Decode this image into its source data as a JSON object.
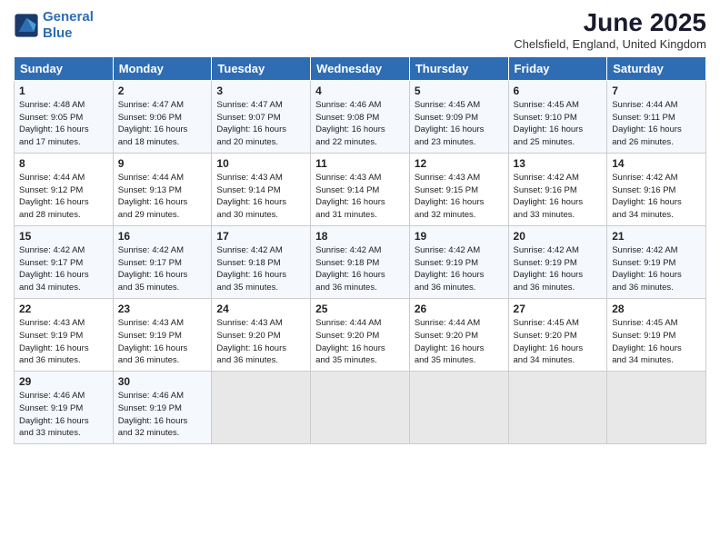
{
  "logo": {
    "line1": "General",
    "line2": "Blue"
  },
  "title": "June 2025",
  "subtitle": "Chelsfield, England, United Kingdom",
  "days_of_week": [
    "Sunday",
    "Monday",
    "Tuesday",
    "Wednesday",
    "Thursday",
    "Friday",
    "Saturday"
  ],
  "weeks": [
    [
      {
        "day": 1,
        "info": "Sunrise: 4:48 AM\nSunset: 9:05 PM\nDaylight: 16 hours\nand 17 minutes."
      },
      {
        "day": 2,
        "info": "Sunrise: 4:47 AM\nSunset: 9:06 PM\nDaylight: 16 hours\nand 18 minutes."
      },
      {
        "day": 3,
        "info": "Sunrise: 4:47 AM\nSunset: 9:07 PM\nDaylight: 16 hours\nand 20 minutes."
      },
      {
        "day": 4,
        "info": "Sunrise: 4:46 AM\nSunset: 9:08 PM\nDaylight: 16 hours\nand 22 minutes."
      },
      {
        "day": 5,
        "info": "Sunrise: 4:45 AM\nSunset: 9:09 PM\nDaylight: 16 hours\nand 23 minutes."
      },
      {
        "day": 6,
        "info": "Sunrise: 4:45 AM\nSunset: 9:10 PM\nDaylight: 16 hours\nand 25 minutes."
      },
      {
        "day": 7,
        "info": "Sunrise: 4:44 AM\nSunset: 9:11 PM\nDaylight: 16 hours\nand 26 minutes."
      }
    ],
    [
      {
        "day": 8,
        "info": "Sunrise: 4:44 AM\nSunset: 9:12 PM\nDaylight: 16 hours\nand 28 minutes."
      },
      {
        "day": 9,
        "info": "Sunrise: 4:44 AM\nSunset: 9:13 PM\nDaylight: 16 hours\nand 29 minutes."
      },
      {
        "day": 10,
        "info": "Sunrise: 4:43 AM\nSunset: 9:14 PM\nDaylight: 16 hours\nand 30 minutes."
      },
      {
        "day": 11,
        "info": "Sunrise: 4:43 AM\nSunset: 9:14 PM\nDaylight: 16 hours\nand 31 minutes."
      },
      {
        "day": 12,
        "info": "Sunrise: 4:43 AM\nSunset: 9:15 PM\nDaylight: 16 hours\nand 32 minutes."
      },
      {
        "day": 13,
        "info": "Sunrise: 4:42 AM\nSunset: 9:16 PM\nDaylight: 16 hours\nand 33 minutes."
      },
      {
        "day": 14,
        "info": "Sunrise: 4:42 AM\nSunset: 9:16 PM\nDaylight: 16 hours\nand 34 minutes."
      }
    ],
    [
      {
        "day": 15,
        "info": "Sunrise: 4:42 AM\nSunset: 9:17 PM\nDaylight: 16 hours\nand 34 minutes."
      },
      {
        "day": 16,
        "info": "Sunrise: 4:42 AM\nSunset: 9:17 PM\nDaylight: 16 hours\nand 35 minutes."
      },
      {
        "day": 17,
        "info": "Sunrise: 4:42 AM\nSunset: 9:18 PM\nDaylight: 16 hours\nand 35 minutes."
      },
      {
        "day": 18,
        "info": "Sunrise: 4:42 AM\nSunset: 9:18 PM\nDaylight: 16 hours\nand 36 minutes."
      },
      {
        "day": 19,
        "info": "Sunrise: 4:42 AM\nSunset: 9:19 PM\nDaylight: 16 hours\nand 36 minutes."
      },
      {
        "day": 20,
        "info": "Sunrise: 4:42 AM\nSunset: 9:19 PM\nDaylight: 16 hours\nand 36 minutes."
      },
      {
        "day": 21,
        "info": "Sunrise: 4:42 AM\nSunset: 9:19 PM\nDaylight: 16 hours\nand 36 minutes."
      }
    ],
    [
      {
        "day": 22,
        "info": "Sunrise: 4:43 AM\nSunset: 9:19 PM\nDaylight: 16 hours\nand 36 minutes."
      },
      {
        "day": 23,
        "info": "Sunrise: 4:43 AM\nSunset: 9:19 PM\nDaylight: 16 hours\nand 36 minutes."
      },
      {
        "day": 24,
        "info": "Sunrise: 4:43 AM\nSunset: 9:20 PM\nDaylight: 16 hours\nand 36 minutes."
      },
      {
        "day": 25,
        "info": "Sunrise: 4:44 AM\nSunset: 9:20 PM\nDaylight: 16 hours\nand 35 minutes."
      },
      {
        "day": 26,
        "info": "Sunrise: 4:44 AM\nSunset: 9:20 PM\nDaylight: 16 hours\nand 35 minutes."
      },
      {
        "day": 27,
        "info": "Sunrise: 4:45 AM\nSunset: 9:20 PM\nDaylight: 16 hours\nand 34 minutes."
      },
      {
        "day": 28,
        "info": "Sunrise: 4:45 AM\nSunset: 9:19 PM\nDaylight: 16 hours\nand 34 minutes."
      }
    ],
    [
      {
        "day": 29,
        "info": "Sunrise: 4:46 AM\nSunset: 9:19 PM\nDaylight: 16 hours\nand 33 minutes."
      },
      {
        "day": 30,
        "info": "Sunrise: 4:46 AM\nSunset: 9:19 PM\nDaylight: 16 hours\nand 32 minutes."
      },
      {
        "day": null,
        "info": ""
      },
      {
        "day": null,
        "info": ""
      },
      {
        "day": null,
        "info": ""
      },
      {
        "day": null,
        "info": ""
      },
      {
        "day": null,
        "info": ""
      }
    ]
  ]
}
